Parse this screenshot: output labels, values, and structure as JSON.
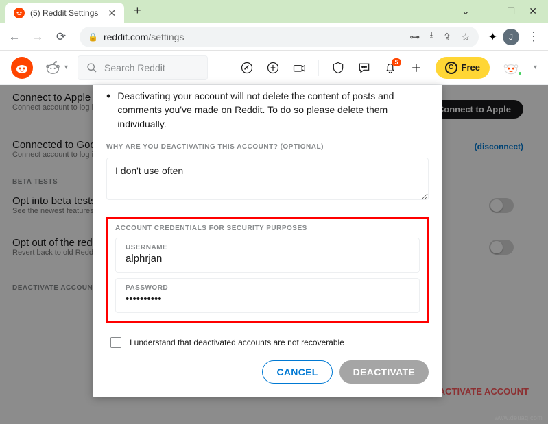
{
  "window": {
    "controls": {
      "min": "—",
      "max": "☐",
      "close": "✕",
      "caret": "⌄"
    }
  },
  "browser": {
    "tab_title": "(5) Reddit Settings",
    "url_domain": "reddit.com",
    "url_path": "/settings",
    "avatar_letter": "J"
  },
  "reddit_header": {
    "search_placeholder": "Search Reddit",
    "notif_count": "5",
    "coin_label": "Free"
  },
  "background": {
    "apple_title": "Connect to Apple",
    "apple_sub": "Connect account to log in to Reddit with Apple",
    "apple_btn": "Connect to Apple",
    "google_title": "Connected to Google",
    "google_sub": "Connect account to log in to Reddit with Google",
    "google_link": "(disconnect)",
    "beta_label": "BETA TESTS",
    "optin_title": "Opt into beta tests",
    "optin_sub": "See the newest features from Reddit and join the r/beta community",
    "optout_title": "Opt out of the redesign",
    "optout_sub": "Revert back to old Reddit for the time being",
    "deact_label": "DEACTIVATE ACCOUNT",
    "deact_link": "DEACTIVATE ACCOUNT"
  },
  "modal": {
    "bullet_text": "Deactivating your account will not delete the content of posts and comments you've made on Reddit. To do so please delete them individually.",
    "why_label": "WHY ARE YOU DEACTIVATING THIS ACCOUNT? (OPTIONAL)",
    "reason_value": "I don't use often",
    "cred_label": "ACCOUNT CREDENTIALS FOR SECURITY PURPOSES",
    "username_label": "USERNAME",
    "username_value": "alphrjan",
    "password_label": "PASSWORD",
    "password_value": "••••••••••",
    "understand_text": "I understand that deactivated accounts are not recoverable",
    "cancel": "CANCEL",
    "deactivate": "DEACTIVATE"
  },
  "watermark": "www.deuaq.com"
}
